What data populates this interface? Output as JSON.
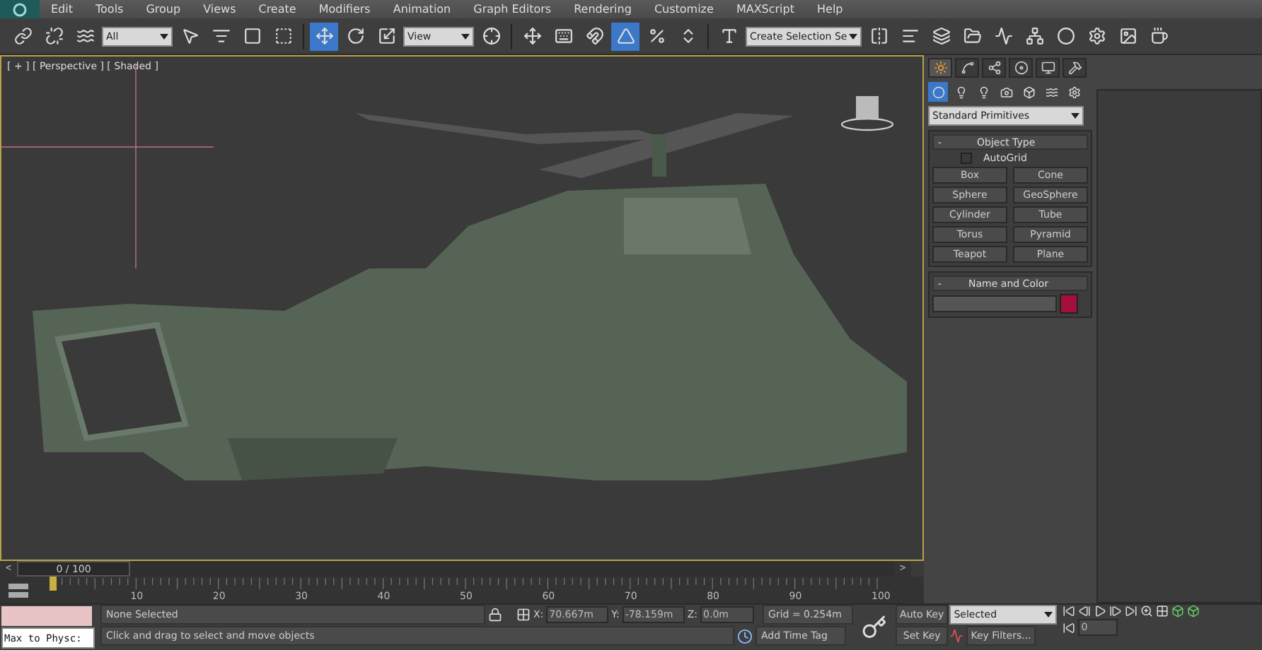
{
  "menu": [
    "Edit",
    "Tools",
    "Group",
    "Views",
    "Create",
    "Modifiers",
    "Animation",
    "Graph Editors",
    "Rendering",
    "Customize",
    "MAXScript",
    "Help"
  ],
  "toolbar": [
    {
      "kind": "tool",
      "selected": false
    },
    {
      "kind": "tool",
      "selected": false
    },
    {
      "kind": "tool",
      "selected": false
    },
    {
      "kind": "dropdown",
      "value": "All"
    },
    {
      "kind": "tool",
      "selected": false
    },
    {
      "kind": "tool",
      "selected": false
    },
    {
      "kind": "tool",
      "selected": false
    },
    {
      "kind": "tool",
      "selected": false
    },
    {
      "kind": "separator"
    },
    {
      "kind": "tool",
      "selected": true
    },
    {
      "kind": "tool",
      "selected": false
    },
    {
      "kind": "tool",
      "selected": false
    },
    {
      "kind": "dropdown",
      "value": "View"
    },
    {
      "kind": "tool",
      "selected": false
    },
    {
      "kind": "separator"
    },
    {
      "kind": "tool",
      "selected": false
    },
    {
      "kind": "tool",
      "selected": false
    },
    {
      "kind": "tool",
      "selected": false
    },
    {
      "kind": "tool",
      "selected": true
    },
    {
      "kind": "tool",
      "selected": false
    },
    {
      "kind": "tool",
      "selected": false
    },
    {
      "kind": "separator"
    },
    {
      "kind": "tool",
      "selected": false
    },
    {
      "kind": "dropdown",
      "value": "Create Selection Se"
    },
    {
      "kind": "tool",
      "selected": false
    },
    {
      "kind": "tool",
      "selected": false
    },
    {
      "kind": "tool",
      "selected": false
    },
    {
      "kind": "tool",
      "selected": false
    },
    {
      "kind": "tool",
      "selected": false
    },
    {
      "kind": "tool",
      "selected": false
    },
    {
      "kind": "tool",
      "selected": false
    },
    {
      "kind": "tool",
      "selected": false
    },
    {
      "kind": "tool",
      "selected": false
    },
    {
      "kind": "tool",
      "selected": false
    }
  ],
  "viewport": {
    "label": "[ + ] [ Perspective ] [ Shaded ]"
  },
  "command_panel": {
    "tabs": [
      {
        "selected": true
      },
      {
        "selected": false
      },
      {
        "selected": false
      },
      {
        "selected": false
      },
      {
        "selected": false
      },
      {
        "selected": false
      }
    ],
    "categories": [
      {
        "selected": true
      },
      {
        "selected": false
      },
      {
        "selected": false
      },
      {
        "selected": false
      },
      {
        "selected": false
      },
      {
        "selected": false
      },
      {
        "selected": false
      }
    ],
    "dropdown": "Standard Primitives",
    "object_type": {
      "toggle": "-",
      "title": "Object Type",
      "autogrid": {
        "label": "AutoGrid",
        "checked": false
      },
      "buttons": [
        "Box",
        "Cone",
        "Sphere",
        "GeoSphere",
        "Cylinder",
        "Tube",
        "Torus",
        "Pyramid",
        "Teapot",
        "Plane"
      ]
    },
    "name_and_color": {
      "toggle": "-",
      "title": "Name and Color",
      "color": "#a3103c"
    }
  },
  "time_slider": {
    "prev": "<",
    "frame": "0 / 100",
    "next": ">",
    "level": 0
  },
  "ruler": {
    "labels": [
      "10",
      "20",
      "30",
      "40",
      "50",
      "60",
      "70",
      "80",
      "90",
      "100"
    ]
  },
  "status": {
    "listener": "Max to Physc:",
    "selection": "None Selected",
    "prompt": "Click and drag to select and move objects",
    "x_label": "X:",
    "x": "70.667m",
    "y_label": "Y:",
    "y": "-78.159m",
    "z_label": "Z:",
    "z": "0.0m",
    "grid": "Grid = 0.254m",
    "time_tag": "Add Time Tag",
    "auto_key": "Auto Key",
    "set_key": "Set Key",
    "key_mode": "Selected",
    "key_filters": "Key Filters...",
    "frame": "0"
  }
}
